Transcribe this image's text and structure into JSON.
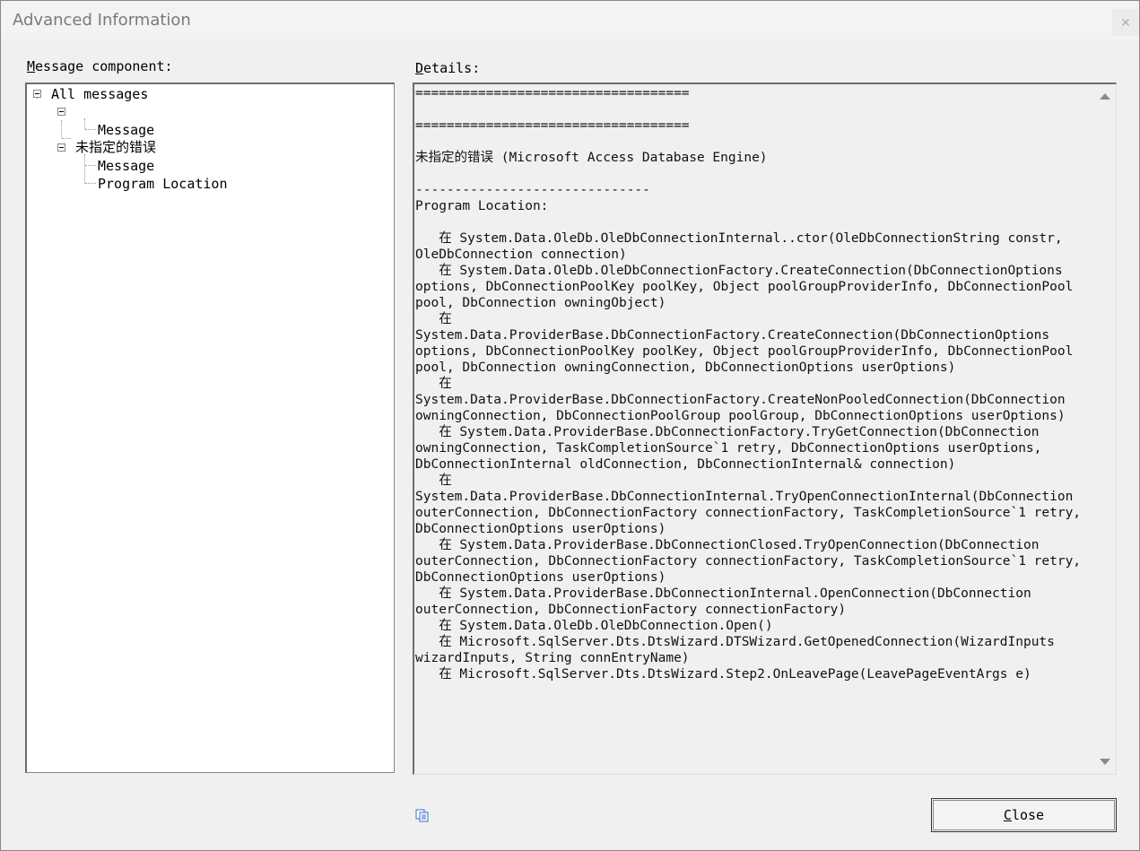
{
  "window": {
    "title": "Advanced Information",
    "close_glyph": "✕"
  },
  "left_panel": {
    "label_mnemonic": "M",
    "label_rest": "essage component:",
    "tree": [
      {
        "text": "All messages",
        "level": 0
      },
      {
        "text": "",
        "level": 1
      },
      {
        "text": "Message",
        "level": 2
      },
      {
        "text": "未指定的错误",
        "level": 1
      },
      {
        "text": "Message",
        "level": 2
      },
      {
        "text": "Program Location",
        "level": 2
      }
    ]
  },
  "right_panel": {
    "label_mnemonic": "D",
    "label_rest": "etails:",
    "details_text": "===================================\n\n===================================\n\n未指定的错误 (Microsoft Access Database Engine)\n\n------------------------------\nProgram Location:\n\n   在 System.Data.OleDb.OleDbConnectionInternal..ctor(OleDbConnectionString constr, OleDbConnection connection)\n   在 System.Data.OleDb.OleDbConnectionFactory.CreateConnection(DbConnectionOptions options, DbConnectionPoolKey poolKey, Object poolGroupProviderInfo, DbConnectionPool pool, DbConnection owningObject)\n   在 System.Data.ProviderBase.DbConnectionFactory.CreateConnection(DbConnectionOptions options, DbConnectionPoolKey poolKey, Object poolGroupProviderInfo, DbConnectionPool pool, DbConnection owningConnection, DbConnectionOptions userOptions)\n   在 System.Data.ProviderBase.DbConnectionFactory.CreateNonPooledConnection(DbConnection owningConnection, DbConnectionPoolGroup poolGroup, DbConnectionOptions userOptions)\n   在 System.Data.ProviderBase.DbConnectionFactory.TryGetConnection(DbConnection owningConnection, TaskCompletionSource`1 retry, DbConnectionOptions userOptions, DbConnectionInternal oldConnection, DbConnectionInternal& connection)\n   在 System.Data.ProviderBase.DbConnectionInternal.TryOpenConnectionInternal(DbConnection outerConnection, DbConnectionFactory connectionFactory, TaskCompletionSource`1 retry, DbConnectionOptions userOptions)\n   在 System.Data.ProviderBase.DbConnectionClosed.TryOpenConnection(DbConnection outerConnection, DbConnectionFactory connectionFactory, TaskCompletionSource`1 retry, DbConnectionOptions userOptions)\n   在 System.Data.ProviderBase.DbConnectionInternal.OpenConnection(DbConnection outerConnection, DbConnectionFactory connectionFactory)\n   在 System.Data.OleDb.OleDbConnection.Open()\n   在 Microsoft.SqlServer.Dts.DtsWizard.DTSWizard.GetOpenedConnection(WizardInputs wizardInputs, String connEntryName)\n   在 Microsoft.SqlServer.Dts.DtsWizard.Step2.OnLeavePage(LeavePageEventArgs e)"
  },
  "footer": {
    "copy_icon": "copy-icon",
    "close_mnemonic": "C",
    "close_rest": "lose"
  }
}
